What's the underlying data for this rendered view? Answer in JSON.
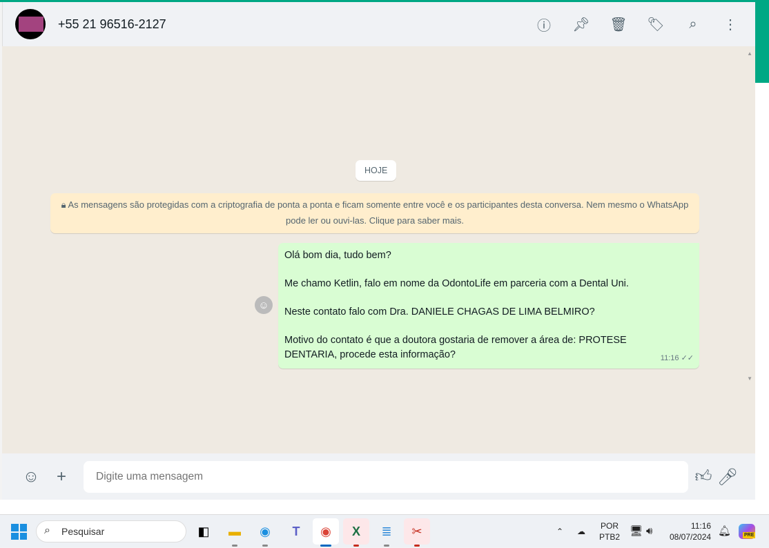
{
  "header": {
    "contact": "+55 21 96516-2127",
    "icons": [
      "info-icon",
      "pin-icon",
      "delete-icon",
      "label-icon",
      "search-icon",
      "menu-icon"
    ]
  },
  "chat": {
    "date_chip": "HOJE",
    "encryption_notice": "As mensagens são protegidas com a criptografia de ponta a ponta e ficam somente entre você e os participantes desta conversa. Nem mesmo o WhatsApp pode ler ou ouvi-las. Clique para saber mais.",
    "message": {
      "lines": [
        "Olá bom dia, tudo bem?",
        "",
        "Me chamo Ketlin, falo em nome da OdontoLife em parceria com a Dental Uni.",
        "",
        "Neste contato falo com Dra. DANIELE CHAGAS DE LIMA BELMIRO?",
        "",
        "Motivo do contato é que a doutora gostaria de remover a área de: PROTESE DENTARIA, procede esta informação?"
      ],
      "time": "11:16",
      "status": "read"
    }
  },
  "footer": {
    "placeholder": "Digite uma mensagem"
  },
  "taskbar": {
    "search": "Pesquisar",
    "lang": "POR",
    "layout": "PTB2",
    "time": "11:16",
    "date": "08/07/2024",
    "copilot_badge": "PRE"
  },
  "colors": {
    "accent": "#00a884",
    "bubble": "#d9fdd3",
    "notice": "#ffeecd"
  }
}
